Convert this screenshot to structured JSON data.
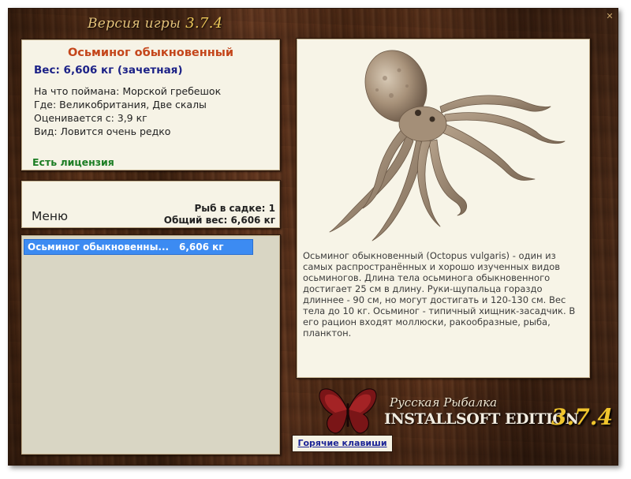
{
  "header": {
    "version_label": "Версия игры",
    "version_number": "3.7.4"
  },
  "fish": {
    "name": "Осьминог обыкновенный",
    "weight_line": "Вес: 6,606 кг (зачетная)",
    "caught_on": "На что поймана: Морской гребешок",
    "location": "Где: Великобритания, Две скалы",
    "rated_from": "Оценивается с: 3,9 кг",
    "kind": "Вид: Ловится очень редко",
    "license": "Есть лицензия",
    "description": "Осьминог обыкновенный (Octopus vulgaris) - один из самых распространённых и хорошо изученных видов осьминогов. Длина тела осьминога обыкновенного достигает 25 см в длину. Руки-щупальца гораздо длиннее - 90 см, но могут достигать и 120-130 см. Вес тела до 10 кг. Осьминог - типичный хищник-засадчик. В его рацион входят моллюски, ракообразные, рыба, планктон."
  },
  "menu": {
    "label": "Меню",
    "fish_in_cage": "Рыб в садке: 1",
    "total_weight": "Общий вес: 6,606 кг"
  },
  "catch_list": [
    {
      "name": "Осьминог обыкновенны...",
      "weight": "6,606 кг"
    }
  ],
  "logo": {
    "subtitle": "Русская Рыбалка",
    "edition": "INSTALLSOFT EDITION",
    "version": "3.7.4"
  },
  "hotkeys_label": "Горячие клавиши",
  "colors": {
    "title": "#c4461b",
    "weight": "#1c2287",
    "license": "#1b7d23",
    "selection": "#3c8bf2",
    "logo_version": "#f0c52d"
  },
  "icons": [
    "close-icon",
    "butterfly-logo-icon",
    "octopus-image"
  ]
}
